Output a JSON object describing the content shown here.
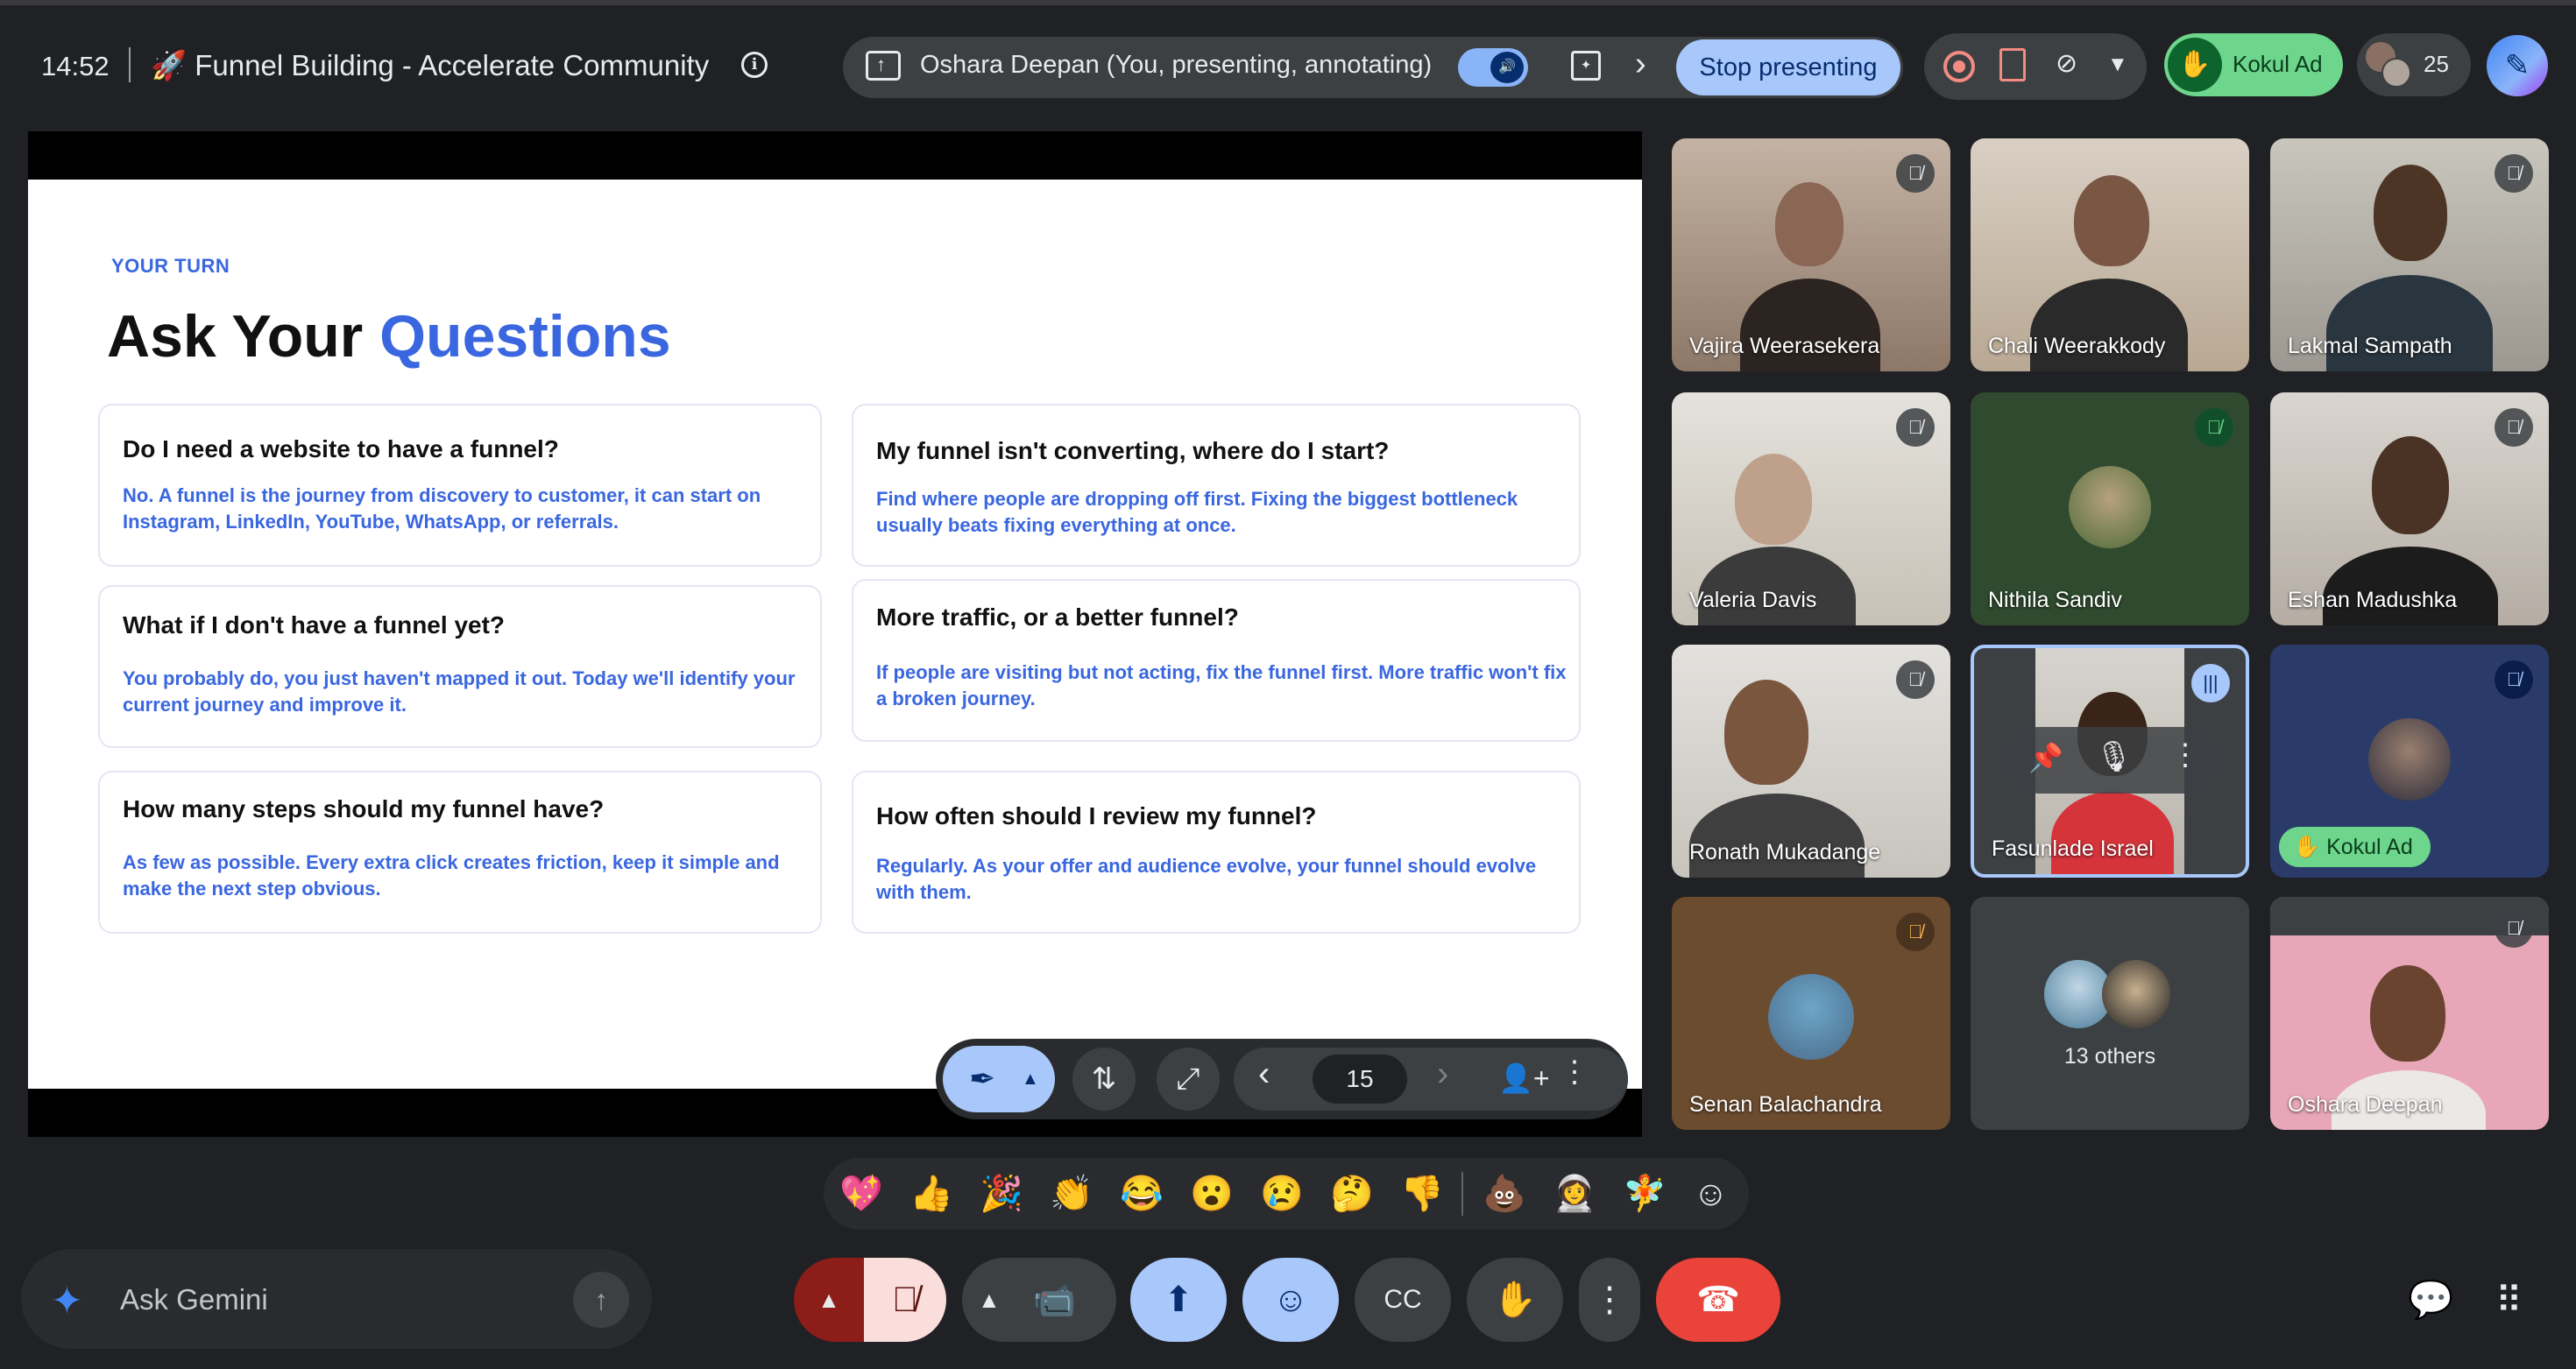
{
  "topbar": {
    "time": "14:52",
    "meeting_title": "🚀 Funnel Building - Accelerate Community",
    "presenter_text": "Oshara Deepan (You, presenting, annotating)",
    "stop_label": "Stop presenting",
    "raised_hand_name": "Kokul Ad",
    "participant_count": "25"
  },
  "slide": {
    "eyebrow": "YOUR TURN",
    "title_plain": "Ask Your ",
    "title_accent": "Questions",
    "cards": [
      {
        "q": "Do I need a website to have a funnel?",
        "a": "No. A funnel is the journey from discovery to customer, it can start on Instagram, LinkedIn, YouTube, WhatsApp, or referrals."
      },
      {
        "q": "What if I don't have a funnel yet?",
        "a": "You probably do, you just haven't mapped it out. Today we'll identify your current journey and improve it."
      },
      {
        "q": "How many steps should my funnel have?",
        "a": "As few as possible. Every extra click creates friction, keep it simple and make the next step obvious."
      },
      {
        "q": "My funnel isn't converting, where do I start?",
        "a": "Find where people are dropping off first. Fixing the biggest bottleneck usually beats fixing everything at once."
      },
      {
        "q": "More traffic, or a better funnel?",
        "a": "If people are visiting but not acting, fix the funnel first. More traffic won't fix a broken journey."
      },
      {
        "q": "How often should I review my funnel?",
        "a": "Regularly. As your offer and audience evolve, your funnel should evolve with them."
      }
    ],
    "page_number": "15"
  },
  "participants": [
    {
      "name": "Vajira Weerasekera"
    },
    {
      "name": "Chali Weerakkody"
    },
    {
      "name": "Lakmal Sampath"
    },
    {
      "name": "Valeria Davis"
    },
    {
      "name": "Nithila Sandiv"
    },
    {
      "name": "Eshan Madushka"
    },
    {
      "name": "Ronath Mukadange"
    },
    {
      "name": "Fasunlade Israel"
    },
    {
      "name": "Kokul Ad"
    },
    {
      "name": "Senan Balachandra"
    },
    {
      "name": "13 others"
    },
    {
      "name": "Oshara Deepan"
    }
  ],
  "reactions": [
    "💖",
    "👍",
    "🎉",
    "👏",
    "😂",
    "😮",
    "😢",
    "🤔",
    "👎",
    "💩",
    "👩‍🚀",
    "🧚"
  ],
  "gemini": {
    "placeholder": "Ask Gemini"
  },
  "colors": {
    "accent": "#3a67e0",
    "end_call": "#e9433a",
    "raised_hand": "#6dd58c",
    "button_blue": "#a8c7fa"
  }
}
